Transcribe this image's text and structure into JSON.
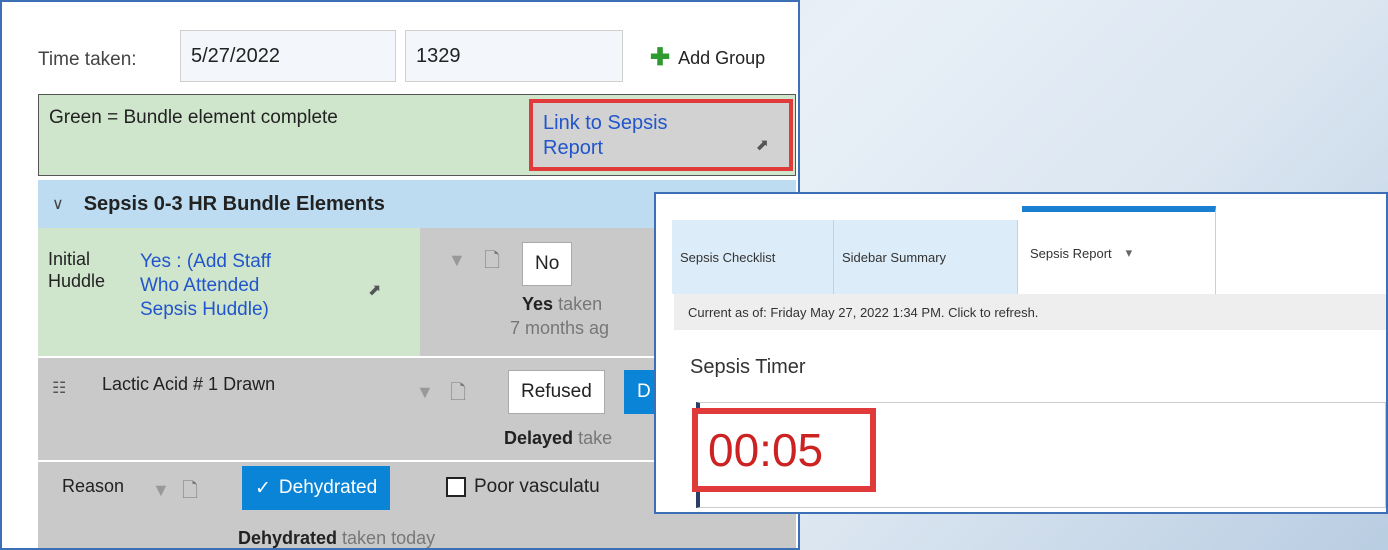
{
  "top_row": {
    "time_label": "Time taken:",
    "date_value": "5/27/2022",
    "time_value": "1329",
    "add_group_label": "Add Group",
    "add_group_icon": "plus-icon"
  },
  "legend_row": {
    "green_note": "Green = Bundle element complete",
    "link_line1": "Link to Sepsis",
    "link_line2": "Report",
    "link_icon": "external-link-icon"
  },
  "section": {
    "title": "Sepsis 0-3 HR Bundle Elements",
    "chevron": "⌄"
  },
  "huddle": {
    "label_line1": "Initial",
    "label_line2": "Huddle",
    "value_line1": "Yes : (Add Staff",
    "value_line2": "Who Attended",
    "value_line3": "Sepsis Huddle)",
    "option_no": "No",
    "taken_bold": "Yes",
    "taken_rest": "taken",
    "ago": "7 months ag"
  },
  "lactic": {
    "label": "Lactic Acid # 1 Drawn",
    "option_refused": "Refused",
    "option_selected": "D",
    "delayed_bold": "Delayed",
    "delayed_rest": "take"
  },
  "reason": {
    "label": "Reason",
    "option_dehydrated": "Dehydrated",
    "option_poor": "Poor vasculatu",
    "taken_bold": "Dehydrated",
    "taken_rest": "taken today"
  },
  "report": {
    "tabs": [
      {
        "label": "Sepsis Checklist"
      },
      {
        "label": "Sidebar Summary"
      },
      {
        "label": "Sepsis Report"
      }
    ],
    "active_tab_caret": "▾",
    "current_as_of": "Current as of: Friday May 27, 2022 1:34 PM. Click to refresh.",
    "timer_title": "Sepsis Timer",
    "timer_value": "00:05"
  },
  "colors": {
    "accent_blue": "#0a84d6",
    "complete_green": "#cfe6cc",
    "highlight_red": "#e03a3a",
    "timer_red": "#cc2222"
  }
}
